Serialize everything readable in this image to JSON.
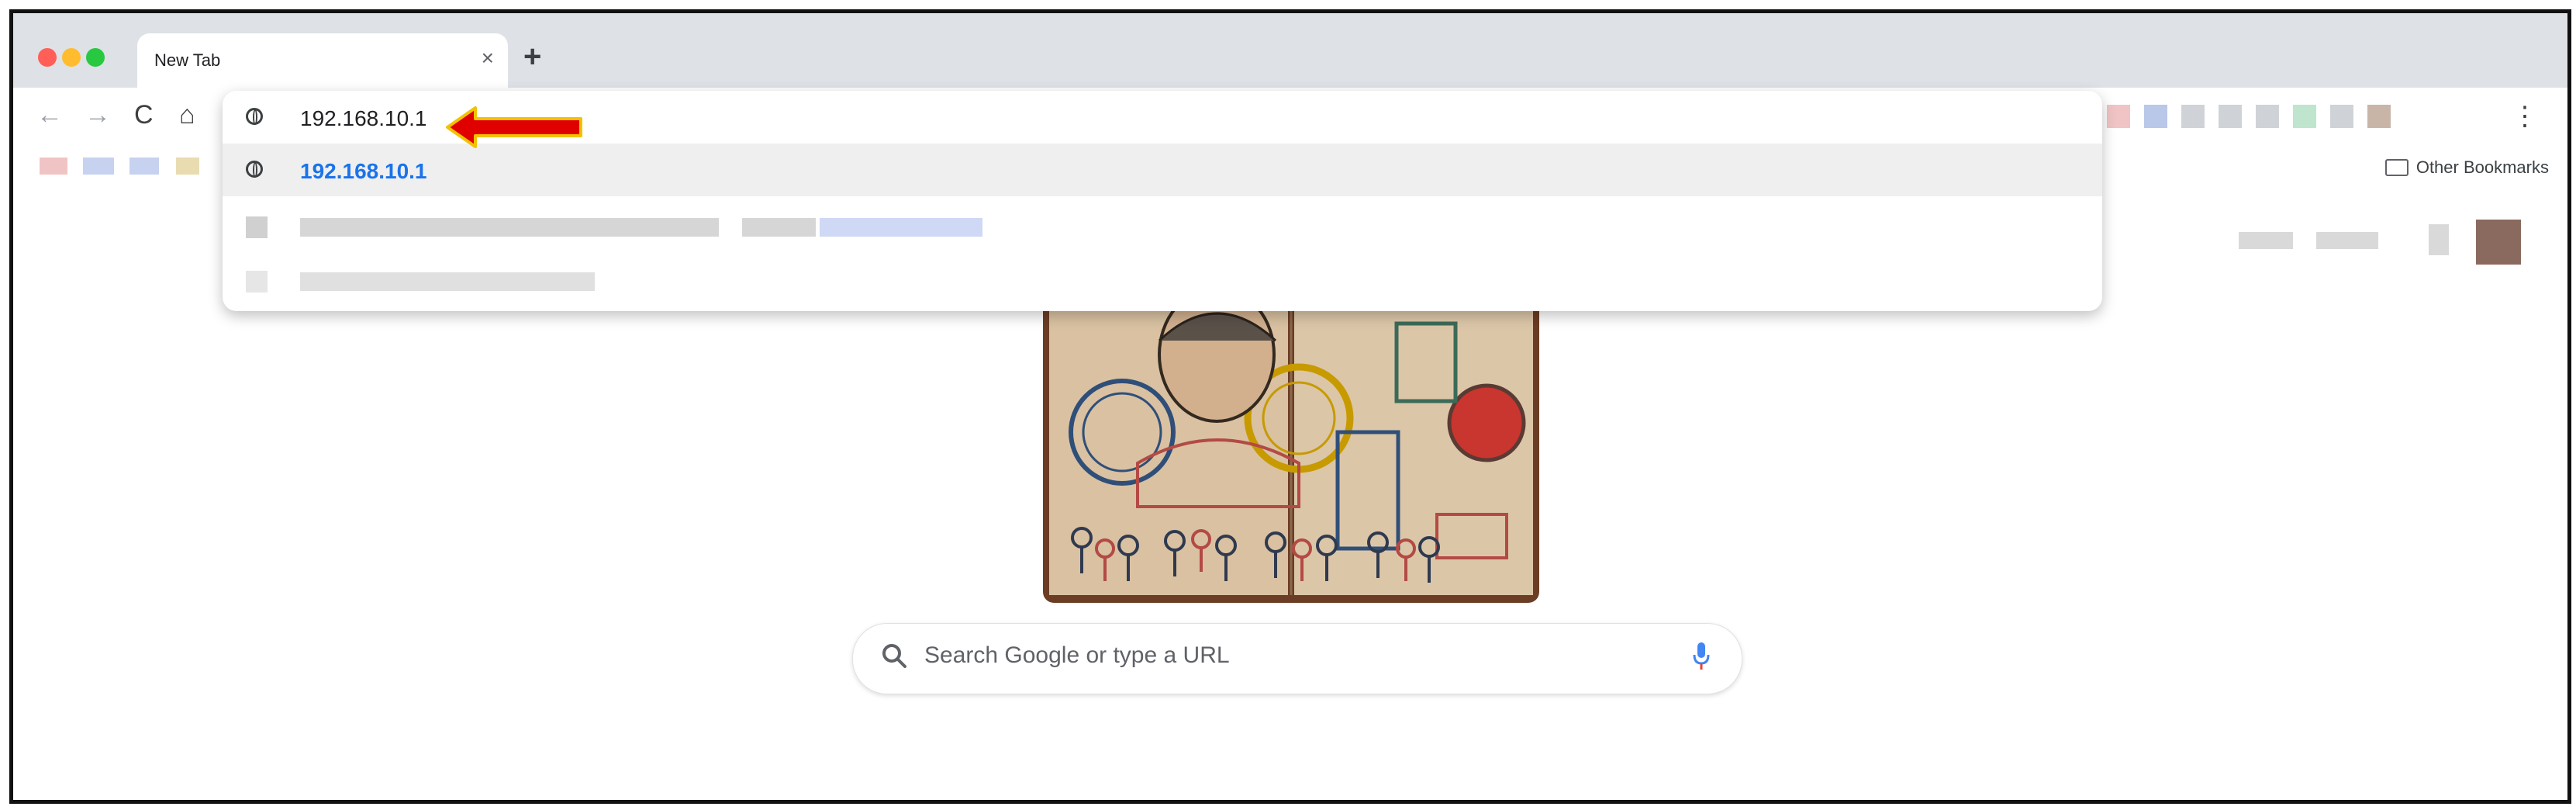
{
  "tab": {
    "title": "New Tab",
    "close": "×"
  },
  "toolbar": {
    "new_tab": "+",
    "back": "←",
    "forward": "→",
    "reload": "C",
    "home": "⌂",
    "menu": "⋮"
  },
  "bookmarks": {
    "other_label": "Other Bookmarks"
  },
  "omnibox": {
    "typed_value": "192.168.10.1",
    "suggestion": "192.168.10.1"
  },
  "search": {
    "placeholder": "Search Google or type a URL"
  },
  "colors": {
    "annotation_arrow": "#e00000",
    "annotation_arrow_outline": "#f2c200",
    "suggestion_link": "#1a73e8",
    "mic_blue": "#4285f4",
    "mic_red": "#ea4335"
  },
  "icons": [
    "globe-icon",
    "search-icon",
    "mic-icon",
    "folder-icon",
    "back-icon",
    "forward-icon",
    "reload-icon",
    "home-icon",
    "menu-icon"
  ]
}
